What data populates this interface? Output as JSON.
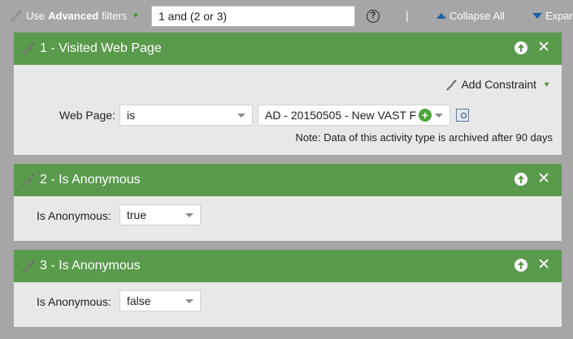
{
  "toolbar": {
    "advanced_prefix": "Use",
    "advanced_bold": "Advanced",
    "advanced_suffix": "filters",
    "filter_logic": "1 and (2 or 3)",
    "help_symbol": "?",
    "separator": "|",
    "collapse_all": "Collapse All",
    "expand_all": "Expar"
  },
  "filters": [
    {
      "title": "1 - Visited Web Page",
      "add_constraint": "Add Constraint",
      "label": "Web Page:",
      "operator": "is",
      "value": "AD - 20150505 - New VAST F",
      "note": "Note: Data of this activity type is archived after 90 days"
    },
    {
      "title": "2 - Is Anonymous",
      "label": "Is Anonymous:",
      "value": "true"
    },
    {
      "title": "3 - Is Anonymous",
      "label": "Is Anonymous:",
      "value": "false"
    }
  ],
  "colors": {
    "panel_header": "#5a9a4c",
    "panel_body": "#e8e8e8",
    "background": "#a6a6a6",
    "link_blue": "#1f5fa8"
  }
}
